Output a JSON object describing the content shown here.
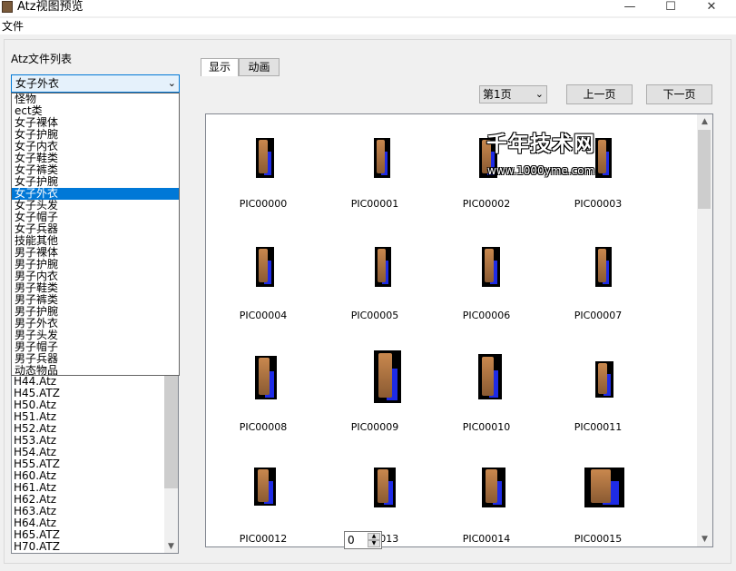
{
  "window": {
    "title": "Atz视图预览",
    "minimize": "—",
    "maximize": "☐",
    "close": "✕"
  },
  "menu": {
    "file": "文件"
  },
  "file_list": {
    "label": "Atz文件列表",
    "combo_value": "女子外衣",
    "dropdown_options": [
      "怪物",
      "ect类",
      "女子裸体",
      "女子护腕",
      "女子内衣",
      "女子鞋类",
      "女子裤类",
      "女子护腕",
      "女子外衣",
      "女子头发",
      "女子帽子",
      "女子兵器",
      "技能其他",
      "男子裸体",
      "男子护腕",
      "男子内衣",
      "男子鞋类",
      "男子裤类",
      "男子护腕",
      "男子外衣",
      "男子头发",
      "男子帽子",
      "男子兵器",
      "动态物品"
    ],
    "selected_option": "女子外衣",
    "files": [
      "H44.Atz",
      "H45.ATZ",
      "H50.Atz",
      "H51.Atz",
      "H52.Atz",
      "H53.Atz",
      "H54.Atz",
      "H55.ATZ",
      "H60.Atz",
      "H61.Atz",
      "H62.Atz",
      "H63.Atz",
      "H64.Atz",
      "H65.ATZ",
      "H70.ATZ"
    ]
  },
  "tabs": {
    "show": "显示",
    "animation": "动画"
  },
  "pager": {
    "page_value": "第1页",
    "prev": "上一页",
    "next": "下一页"
  },
  "images": [
    "PIC00000",
    "PIC00001",
    "PIC00002",
    "PIC00003",
    "PIC00004",
    "PIC00005",
    "PIC00006",
    "PIC00007",
    "PIC00008",
    "PIC00009",
    "PIC00010",
    "PIC00011",
    "PIC00012",
    "PIC00013",
    "PIC00014",
    "PIC00015"
  ],
  "watermark": {
    "title": "千年技术网",
    "url": "www.1000yme.com"
  },
  "spinner": {
    "value": "0"
  },
  "colors": {
    "selection": "#0078d7",
    "sprite_cape": "#1e2be6",
    "sprite_body": "#c9884e"
  },
  "icons": {
    "combo_arrow": "chevron-down-icon",
    "scroll_up": "scroll-up-icon",
    "scroll_down": "scroll-down-icon"
  }
}
